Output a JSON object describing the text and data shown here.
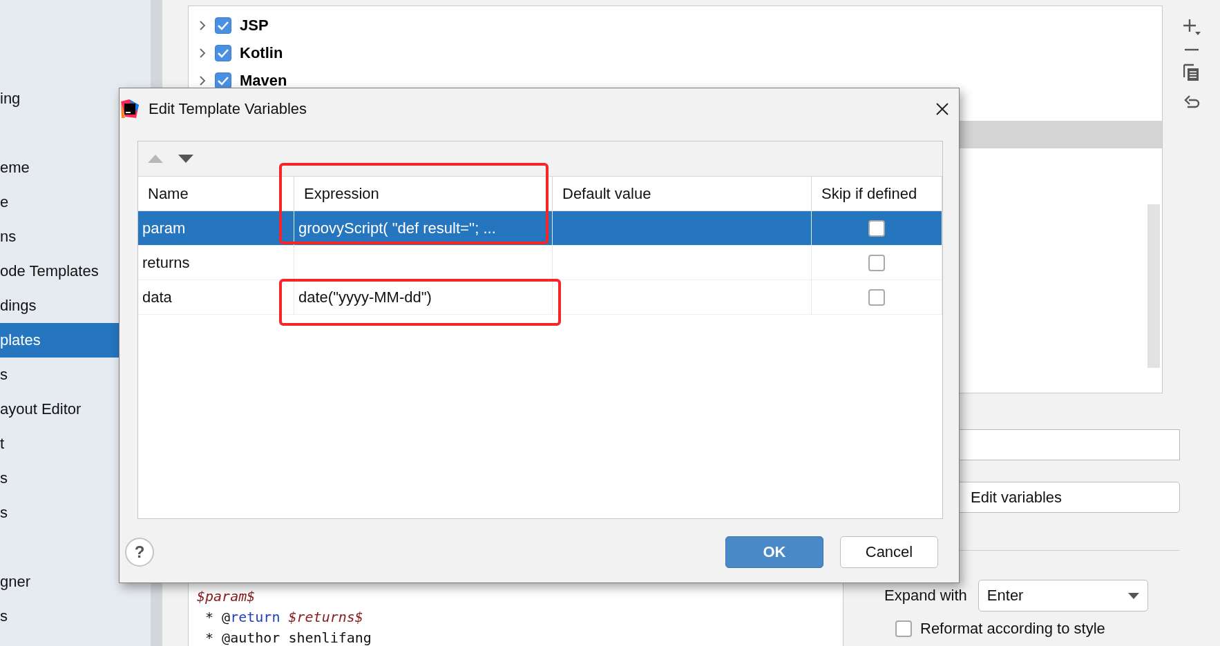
{
  "sidebar": {
    "items": [
      {
        "label": "ing",
        "selected": false
      },
      {
        "selected": false
      },
      {
        "label": "eme",
        "selected": false
      },
      {
        "label": "e",
        "selected": false
      },
      {
        "label": "ns",
        "selected": false
      },
      {
        "label": "ode Templates",
        "selected": false
      },
      {
        "label": "dings",
        "selected": false
      },
      {
        "label": "plates",
        "selected": true
      },
      {
        "label": "s",
        "selected": false
      },
      {
        "label": "ayout Editor",
        "selected": false
      },
      {
        "label": "t",
        "selected": false
      },
      {
        "label": "s",
        "selected": false
      },
      {
        "label": "s",
        "selected": false
      },
      {
        "selected": false
      },
      {
        "label": "gner",
        "selected": false
      },
      {
        "label": "s",
        "selected": false
      }
    ]
  },
  "tree": {
    "items": [
      {
        "label": "JSP",
        "checked": true,
        "expanded": false
      },
      {
        "label": "Kotlin",
        "checked": true,
        "expanded": false
      },
      {
        "label": "Maven",
        "checked": true,
        "expanded": false
      }
    ]
  },
  "template": {
    "edit_variables_button": "Edit variables",
    "expand_with": {
      "label": "Expand with",
      "value": "Enter"
    },
    "reformat": {
      "label": "Reformat according to style",
      "checked": false
    },
    "editor_lines": [
      {
        "tokens": [
          {
            "text": "$param$",
            "kind": "variable"
          }
        ]
      },
      {
        "tokens": [
          {
            "text": " * @",
            "kind": "plain"
          },
          {
            "text": "return",
            "kind": "tag"
          },
          {
            "text": " $returns$",
            "kind": "variable"
          }
        ]
      },
      {
        "tokens": [
          {
            "text": " * @author shenlifang",
            "kind": "plain"
          }
        ]
      }
    ]
  },
  "dialog": {
    "title": "Edit Template Variables",
    "toolbar": [
      {
        "kind": "up",
        "disabled": true
      },
      {
        "kind": "down",
        "disabled": false
      }
    ],
    "columns": [
      {
        "label": "Name",
        "highlighted": false
      },
      {
        "label": "Expression",
        "highlighted": true
      },
      {
        "label": "Default value",
        "highlighted": false
      },
      {
        "label": "Skip if defined",
        "highlighted": false
      }
    ],
    "rows": [
      {
        "name": "param",
        "expression": "groovyScript( \"def result=''; ...",
        "default_value": "",
        "skip_if_defined": false,
        "selected": true,
        "highlighted": false
      },
      {
        "name": "returns",
        "expression": "",
        "default_value": "",
        "skip_if_defined": false,
        "selected": false,
        "highlighted": false
      },
      {
        "name": "data",
        "expression": "date(\"yyyy-MM-dd\")",
        "default_value": "",
        "skip_if_defined": false,
        "selected": false,
        "highlighted": true
      }
    ],
    "help": "?",
    "buttons": [
      {
        "label": "OK",
        "kind": "primary"
      },
      {
        "label": "Cancel",
        "kind": "secondary"
      }
    ]
  }
}
